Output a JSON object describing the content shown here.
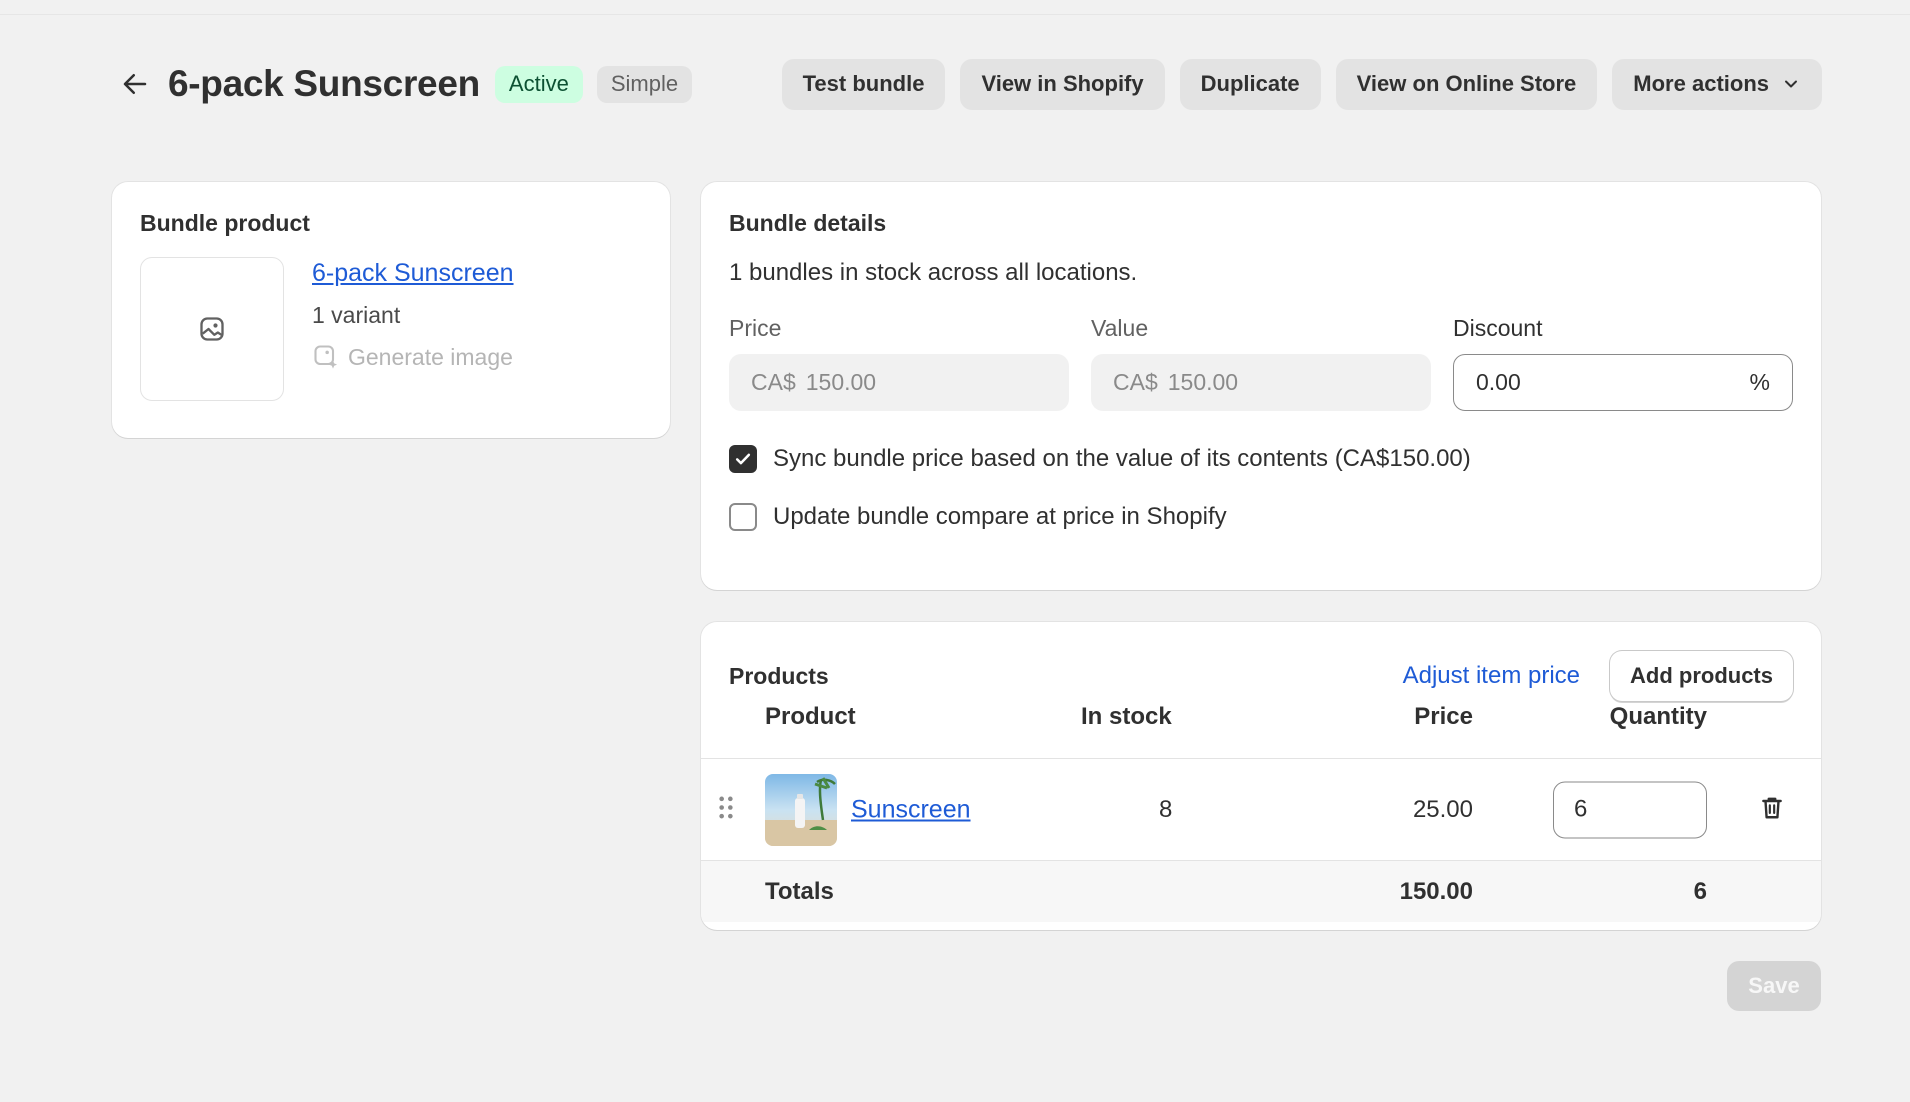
{
  "header": {
    "title": "6-pack Sunscreen",
    "status_badge": "Active",
    "type_badge": "Simple",
    "actions": [
      "Test bundle",
      "View in Shopify",
      "Duplicate",
      "View on Online Store",
      "More actions"
    ]
  },
  "bundle_product": {
    "title": "Bundle product",
    "product_link": "6-pack Sunscreen",
    "variants": "1 variant",
    "generate_image": "Generate image"
  },
  "bundle_details": {
    "title": "Bundle details",
    "stock_text": "1 bundles in stock across all locations.",
    "price": {
      "label": "Price",
      "prefix": "CA$",
      "value": "150.00"
    },
    "value": {
      "label": "Value",
      "prefix": "CA$",
      "value": "150.00"
    },
    "discount": {
      "label": "Discount",
      "value": "0.00",
      "suffix": "%"
    },
    "sync_checkbox": {
      "label": "Sync bundle price based on the value of its contents (CA$150.00)",
      "checked": true
    },
    "compare_checkbox": {
      "label": "Update bundle compare at price in Shopify",
      "checked": false
    }
  },
  "products": {
    "title": "Products",
    "adjust_link": "Adjust item price",
    "add_button": "Add products",
    "columns": [
      "Product",
      "In stock",
      "Price",
      "Quantity"
    ],
    "rows": [
      {
        "name": "Sunscreen",
        "in_stock": "8",
        "price": "25.00",
        "quantity": "6"
      }
    ],
    "totals": {
      "label": "Totals",
      "price": "150.00",
      "quantity": "6"
    }
  },
  "save_button": "Save",
  "colors": {
    "accent_link": "#1e5bd6",
    "active_badge_bg": "#cdfee1",
    "background": "#f1f1f1"
  }
}
